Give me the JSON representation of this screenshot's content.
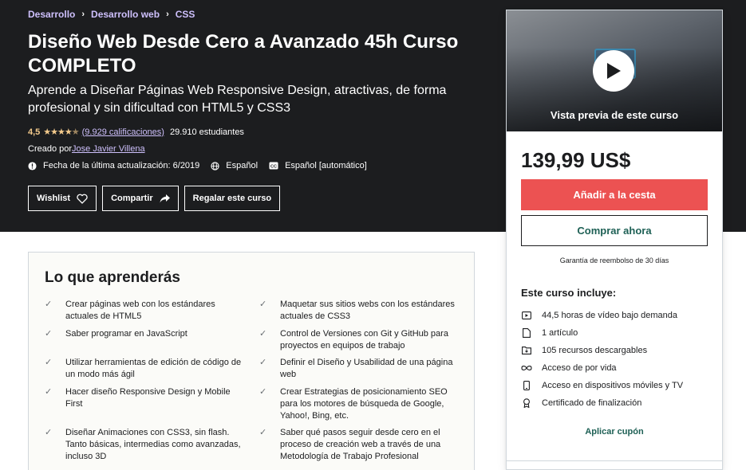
{
  "breadcrumb": [
    "Desarrollo",
    "Desarrollo web",
    "CSS"
  ],
  "course": {
    "title": "Diseño Web Desde Cero a Avanzado 45h Curso COMPLETO",
    "subtitle": "Aprende a Diseñar Páginas Web Responsive Design, atractivas, de forma profesional y sin dificultad con HTML5 y CSS3",
    "rating": "4,5",
    "rating_value": 4.5,
    "ratings_count": "(9.929 calificaciones)",
    "students": "29.910 estudiantes",
    "created_by_label": "Creado por",
    "author": "Jose Javier Villena",
    "last_update": "Fecha de la última actualización: 6/2019",
    "language": "Español",
    "captions": "Español [automático]"
  },
  "actions": {
    "wishlist": "Wishlist",
    "share": "Compartir",
    "gift": "Regalar este curso"
  },
  "sidebar": {
    "preview_label": "Vista previa de este curso",
    "price": "139,99 US$",
    "add_to_cart": "Añadir a la cesta",
    "buy_now": "Comprar ahora",
    "guarantee": "Garantía de reembolso de 30 días",
    "includes_title": "Este curso incluye:",
    "includes": [
      {
        "icon": "video-icon",
        "text": "44,5 horas de vídeo bajo demanda"
      },
      {
        "icon": "file-icon",
        "text": "1 artículo"
      },
      {
        "icon": "folder-download-icon",
        "text": "105 recursos descargables"
      },
      {
        "icon": "infinity-icon",
        "text": "Acceso de por vida"
      },
      {
        "icon": "mobile-icon",
        "text": "Acceso en dispositivos móviles y TV"
      },
      {
        "icon": "certificate-icon",
        "text": "Certificado de finalización"
      }
    ],
    "coupon": "Aplicar cupón"
  },
  "learn": {
    "title": "Lo que aprenderás",
    "left": [
      "Crear páginas web con los estándares actuales de HTML5",
      "Saber programar en JavaScript",
      "Utilizar herramientas de edición de código de un modo más ágil",
      "Hacer diseño Responsive Design y Mobile First",
      "Diseñar Animaciones con CSS3, sin flash. Tanto básicas, intermedias como avanzadas, incluso 3D"
    ],
    "right": [
      "Maquetar sus sitios webs con los estándares actuales de CSS3",
      "Control de Versiones con Git y GitHub para proyectos en equipos de trabajo",
      "Definir el Diseño y Usabilidad de una página web",
      "Crear Estrategias de posicionamiento SEO para los motores de búsqueda de Google, Yahoo!, Bing, etc.",
      "Saber qué pasos seguir desde cero en el proceso de creación web a través de una Metodología de Trabajo Profesional"
    ]
  },
  "colors": {
    "hero_bg": "#1c1d1f",
    "link_purple": "#cec0fc",
    "star": "#f3ca8c",
    "cart_red": "#ec5252",
    "teal": "#1e6055"
  }
}
